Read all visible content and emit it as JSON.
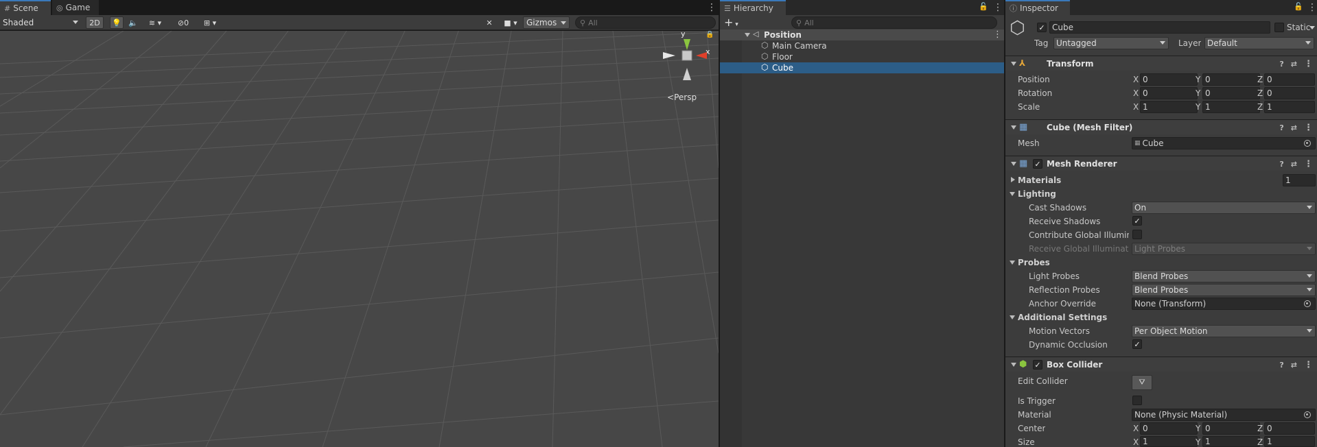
{
  "scene_tabs": [
    {
      "icon": "#",
      "label": "Scene"
    },
    {
      "icon": "◎",
      "label": "Game"
    }
  ],
  "scene_toolbar": {
    "draw_mode": "Shaded",
    "btn_2d": "2D",
    "hidden_count": "0",
    "gizmos": "Gizmos",
    "search_placeholder": "All"
  },
  "gizmo": {
    "y": "y",
    "x": "x",
    "persp": "Persp"
  },
  "hierarchy": {
    "tab": "Hierarchy",
    "add_label": "+",
    "search_placeholder": "All",
    "scene_name": "Position",
    "items": [
      {
        "label": "Main Camera"
      },
      {
        "label": "Floor"
      },
      {
        "label": "Cube"
      }
    ],
    "selected": "Cube"
  },
  "inspector": {
    "tab": "Inspector",
    "object_name": "Cube",
    "active": true,
    "static_label": "Static",
    "tag_label": "Tag",
    "tag_value": "Untagged",
    "layer_label": "Layer",
    "layer_value": "Default",
    "transform": {
      "title": "Transform",
      "position": {
        "label": "Position",
        "x": "0",
        "y": "0",
        "z": "0"
      },
      "rotation": {
        "label": "Rotation",
        "x": "0",
        "y": "0",
        "z": "0"
      },
      "scale": {
        "label": "Scale",
        "x": "1",
        "y": "1",
        "z": "1"
      }
    },
    "mesh_filter": {
      "title": "Cube (Mesh Filter)",
      "mesh_label": "Mesh",
      "mesh_value": "Cube"
    },
    "mesh_renderer": {
      "title": "Mesh Renderer",
      "materials_label": "Materials",
      "materials_count": "1",
      "lighting_label": "Lighting",
      "cast_shadows_label": "Cast Shadows",
      "cast_shadows_value": "On",
      "receive_shadows_label": "Receive Shadows",
      "contribute_gi_label": "Contribute Global Illuminat",
      "receive_gi_label": "Receive Global Illuminatio",
      "receive_gi_value": "Light Probes",
      "probes_label": "Probes",
      "light_probes_label": "Light Probes",
      "light_probes_value": "Blend Probes",
      "reflection_probes_label": "Reflection Probes",
      "reflection_probes_value": "Blend Probes",
      "anchor_override_label": "Anchor Override",
      "anchor_override_value": "None (Transform)",
      "additional_label": "Additional Settings",
      "motion_vectors_label": "Motion Vectors",
      "motion_vectors_value": "Per Object Motion",
      "dynamic_occlusion_label": "Dynamic Occlusion"
    },
    "box_collider": {
      "title": "Box Collider",
      "edit_collider_label": "Edit Collider",
      "is_trigger_label": "Is Trigger",
      "material_label": "Material",
      "material_value": "None (Physic Material)",
      "center": {
        "label": "Center",
        "x": "0",
        "y": "0",
        "z": "0"
      },
      "size": {
        "label": "Size",
        "x": "1",
        "y": "1",
        "z": "1"
      }
    },
    "axis": {
      "x": "X",
      "y": "Y",
      "z": "Z"
    }
  },
  "colors": {
    "selection": "#2c5d87",
    "tab_accent": "#3a79bb",
    "viewport": "#474747",
    "gizmo_x": "#e0402a",
    "gizmo_y": "#8bc53f"
  }
}
